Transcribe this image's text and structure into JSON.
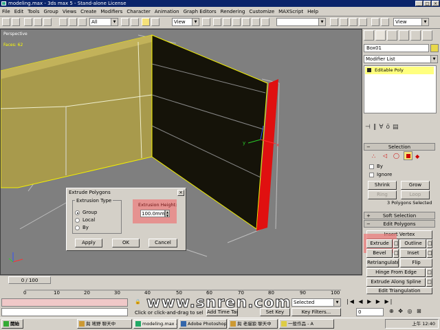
{
  "window": {
    "title": "modeling.max - 3ds max 5 - Stand-alone License"
  },
  "menu": [
    "File",
    "Edit",
    "Tools",
    "Group",
    "Views",
    "Create",
    "Modifiers",
    "Character",
    "Animation",
    "Graph Editors",
    "Rendering",
    "Customize",
    "MAXScript",
    "Help"
  ],
  "toolbar": {
    "selection_filter": "All",
    "ref_coord": "View",
    "named_sel": "",
    "render_view": "View"
  },
  "viewport": {
    "label": "Perspective",
    "stat": "Faces: 62"
  },
  "command_panel": {
    "object_name": "Box01",
    "modifier_list": "Modifier List",
    "stack_item": "Editable Poly",
    "selection_rollout": "Selection",
    "by_vertex": "By",
    "ignore_backfacing": "Ignore",
    "shrink": "Shrink",
    "grow": "Grow",
    "ring": "Ring",
    "loop": "Loop",
    "sel_info": "3 Polygons Selected",
    "soft_selection": "Soft Selection",
    "edit_polygons": "Edit Polygons",
    "insert_vertex": "Insert Vertex",
    "extrude": "Extrude",
    "outline": "Outline",
    "bevel": "Bevel",
    "inset": "Inset",
    "retriangulate": "Retriangulate",
    "flip": "Flip",
    "hinge": "Hinge From Edge",
    "extrude_along_spline": "Extrude Along Spline",
    "edit_triangulation": "Edit Triangulation"
  },
  "dialog": {
    "title": "Extrude Polygons",
    "group_label": "Extrusion Type",
    "opt_group": "Group",
    "opt_local": "Local",
    "opt_by": "By",
    "height_label": "Extrusion Height:",
    "height_value": "100.0mm",
    "apply": "Apply",
    "ok": "OK",
    "cancel": "Cancel"
  },
  "timeline": {
    "frame": "0 / 100",
    "ticks": [
      "0",
      "10",
      "20",
      "30",
      "40",
      "50",
      "60",
      "70",
      "80",
      "90",
      "100"
    ]
  },
  "status": {
    "prompt": "Click or click-and-drag to sel",
    "add_time_tag": "Add Time Tag",
    "set_key": "Set Key",
    "key_filters": "Key Filters...",
    "selected": "Selected",
    "frame_field": "0"
  },
  "watermark": "www.snren.com",
  "taskbar": {
    "start": "開始",
    "tasks": [
      "與 瑤野 聊天中",
      "modeling.max -",
      "Adobe Photoshop",
      "與 老貓狼 聊天中",
      "一般作品 - A"
    ],
    "clock": "上午 12:40"
  },
  "colors": {
    "title_bg": "#0a246a",
    "wall_yellow": "#a89a4c",
    "wall_dark": "#151309",
    "selected_red": "#e01010",
    "highlight": "#ec7878"
  }
}
